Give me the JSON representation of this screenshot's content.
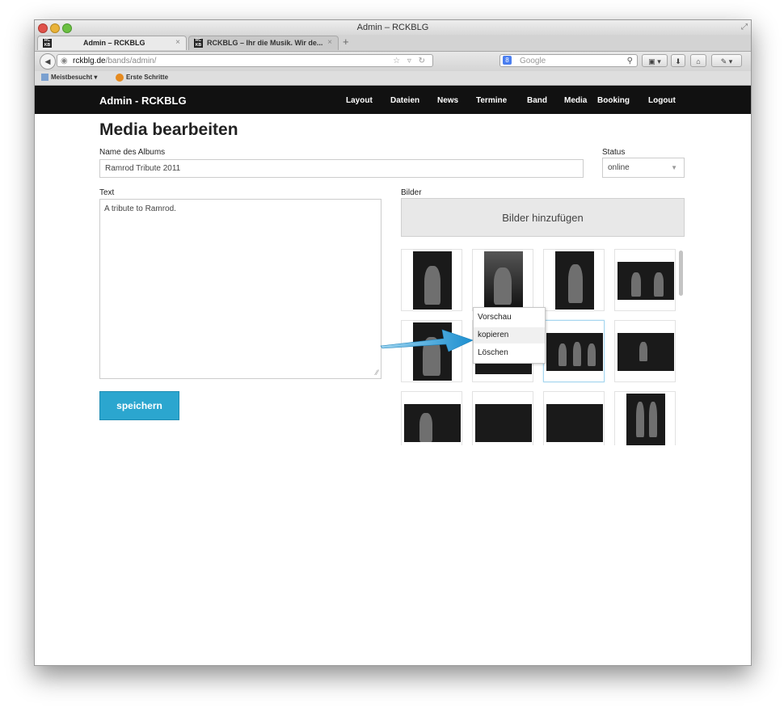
{
  "window": {
    "title": "Admin – RCKBLG"
  },
  "tabs": [
    {
      "label": "Admin – RCKBLG"
    },
    {
      "label": "RCKBLG – Ihr die Musik. Wir de..."
    }
  ],
  "address": {
    "host": "rckblg.de",
    "path": "/bands/admin/"
  },
  "search": {
    "placeholder": "Google"
  },
  "bookmarks": [
    {
      "label": "Meistbesucht ▾"
    },
    {
      "label": "Erste Schritte"
    }
  ],
  "app": {
    "brand": "Admin - RCKBLG",
    "nav": [
      "Layout",
      "Dateien",
      "News",
      "Termine",
      "Band",
      "Media",
      "Booking",
      "Logout"
    ]
  },
  "form": {
    "page_title": "Media bearbeiten",
    "album_label": "Name des Albums",
    "album_value": "Ramrod Tribute 2011",
    "status_label": "Status",
    "status_value": "online",
    "text_label": "Text",
    "text_value": "A tribute to Ramrod.",
    "images_label": "Bilder",
    "add_images": "Bilder hinzufügen",
    "save": "speichern"
  },
  "context_menu": [
    "Vorschau",
    "kopieren",
    "Löschen"
  ],
  "colors": {
    "accent": "#2ba6cf",
    "navbar": "#111111"
  }
}
